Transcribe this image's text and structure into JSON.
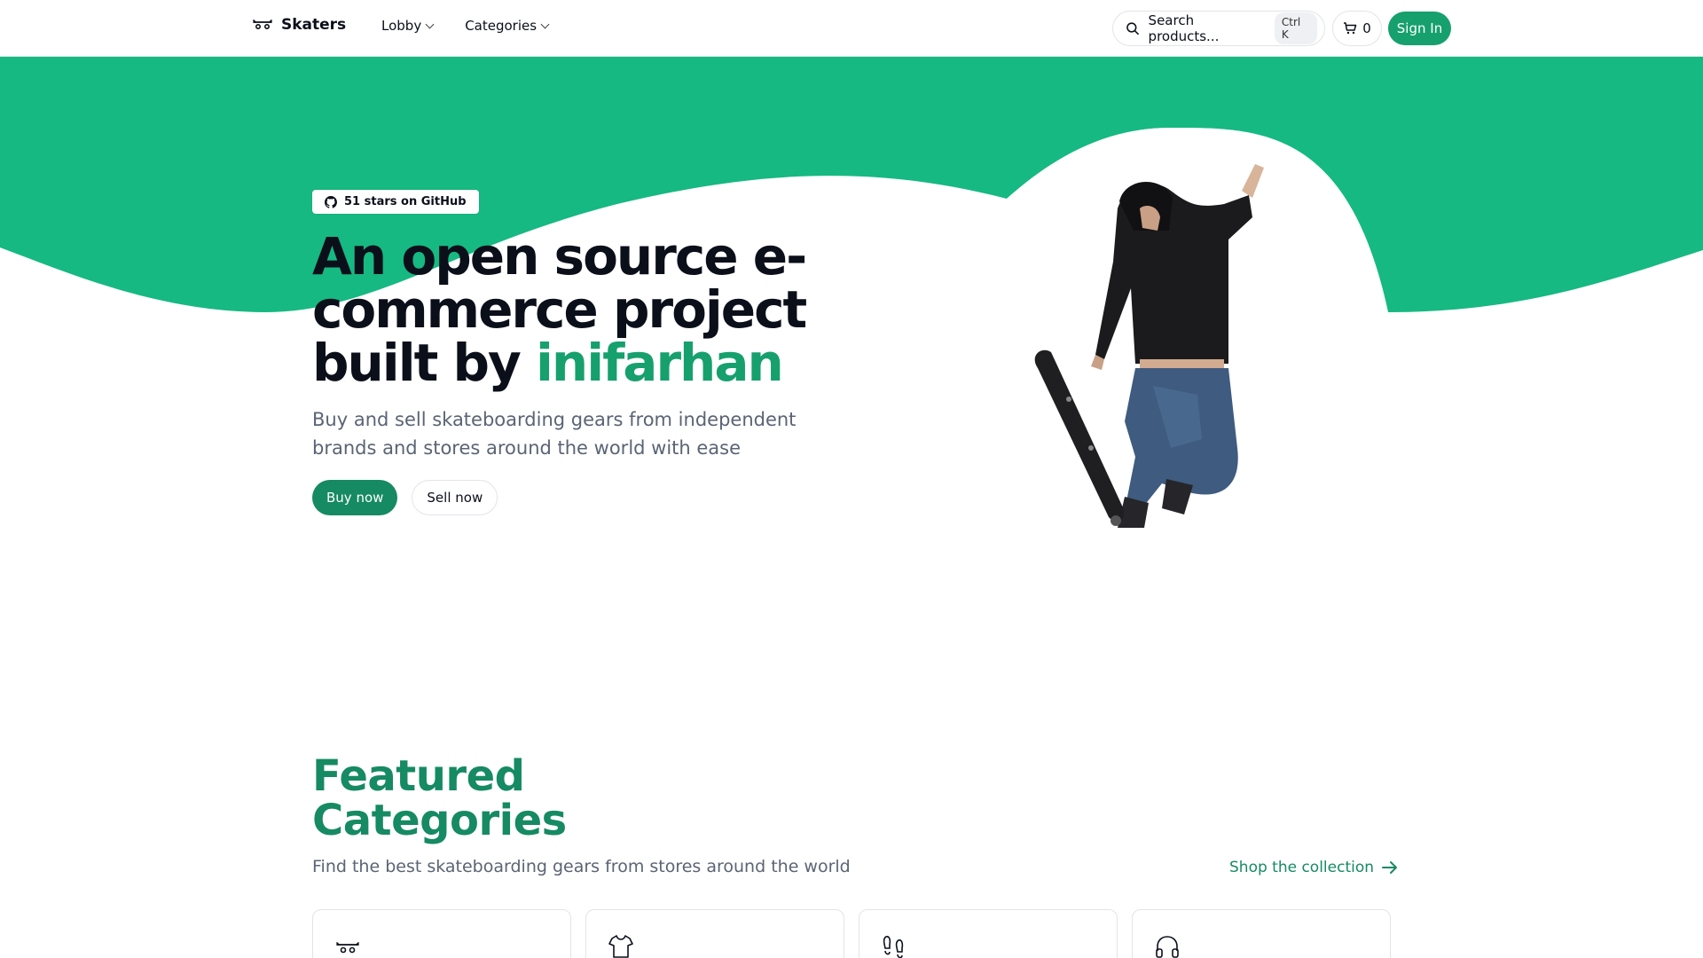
{
  "brand": {
    "name": "Skaters",
    "icon": "skateboard-icon"
  },
  "nav": {
    "items": [
      {
        "label": "Lobby",
        "icon": "chevron-down-icon"
      },
      {
        "label": "Categories",
        "icon": "chevron-down-icon"
      }
    ]
  },
  "search": {
    "placeholder": "Search products...",
    "shortcut": "Ctrl K",
    "icon": "search-icon"
  },
  "cart": {
    "count": "0",
    "icon": "cart-icon"
  },
  "signin": {
    "label": "Sign In"
  },
  "hero": {
    "badge": {
      "text": "51 stars on GitHub",
      "icon": "github-icon"
    },
    "title_part1": "An open source e-commerce project built by ",
    "title_accent": "inifarhan",
    "subtitle": "Buy and sell skateboarding gears from independent brands and stores around the world with ease",
    "buy_label": "Buy now",
    "sell_label": "Sell now"
  },
  "featured": {
    "title": "Featured Categories",
    "subtitle": "Find the best skateboarding gears from stores around the world",
    "shop_link": "Shop the collection",
    "categories": [
      {
        "icon": "skateboard-icon"
      },
      {
        "icon": "tshirt-icon"
      },
      {
        "icon": "footprints-icon"
      },
      {
        "icon": "headphones-icon"
      }
    ]
  },
  "colors": {
    "brand_green": "#16a06d",
    "accent_green": "#168a62",
    "text_dark": "#0b0f1a",
    "text_muted": "#5a6474"
  }
}
